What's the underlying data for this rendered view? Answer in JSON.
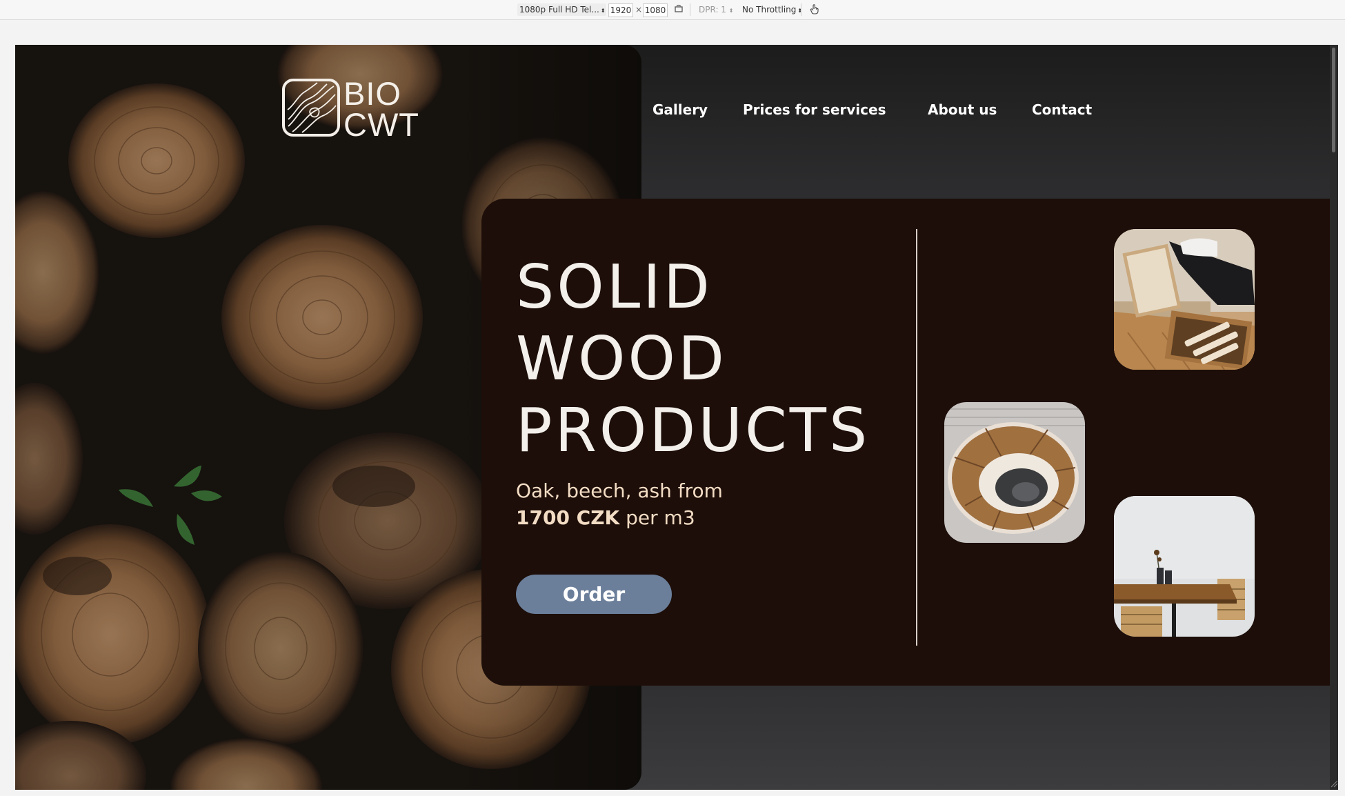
{
  "devtools": {
    "device": "1080p Full HD Tel...",
    "width": "1920",
    "times": "×",
    "height": "1080",
    "dpr": "DPR: 1",
    "throttling": "No Throttling"
  },
  "logo": {
    "line1": "BIO",
    "line2": "CWT"
  },
  "nav": {
    "gallery": "Gallery",
    "prices": "Prices for services",
    "about": "About us",
    "contact": "Contact"
  },
  "hero": {
    "title_line1": "SOLID",
    "title_line2": "WOOD",
    "title_line3": "PRODUCTS",
    "subtitle_line1": "Oak, beech, ash from",
    "price": "1700 CZK",
    "unit": " per m3",
    "order_label": "Order"
  },
  "colors": {
    "page_background": "#2b2b2d",
    "hero_card": "#1d0e09",
    "order_button": "#6b7f9b",
    "subtitle_text": "#f3dcc4",
    "title_text": "#f3efeb"
  },
  "icons": {
    "device_select": "caret-updown-icon",
    "rotate": "rotate-device-icon",
    "touch": "touch-hand-icon",
    "logo_mark": "wood-grain-logo-icon"
  }
}
